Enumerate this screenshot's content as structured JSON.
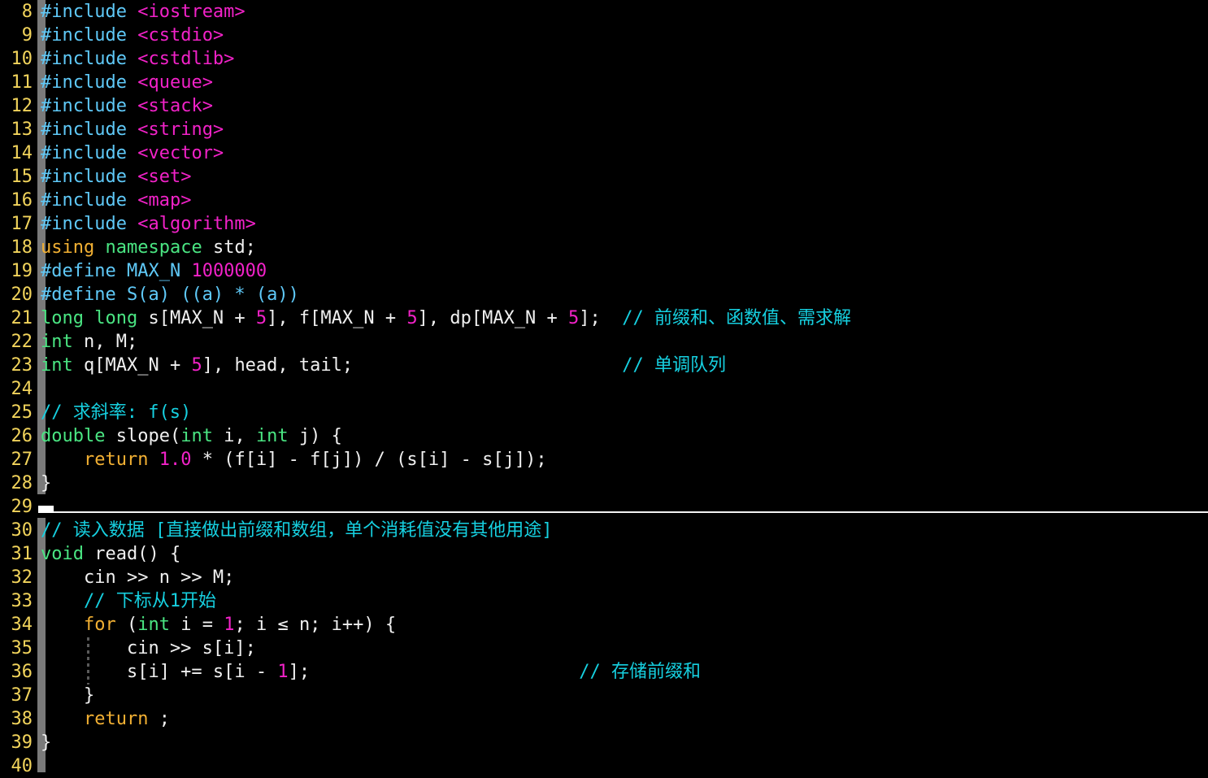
{
  "editor": {
    "name": "code-editor",
    "language": "cpp",
    "first_line": 8,
    "last_line": 40,
    "background": "#000000",
    "gutter_color": "#f2d45c",
    "fold_bar_color": "#7a7a7a",
    "separator_color": "#f2f2f2",
    "colors": {
      "preprocessor": "#5fc9f8",
      "header": "#f222c8",
      "keyword": "#f2b033",
      "type": "#4ae582",
      "number": "#f222c8",
      "plain": "#f0f0f0",
      "comment": "#16d0e0"
    }
  },
  "lines": [
    {
      "n": "8",
      "text": "#include <iostream>"
    },
    {
      "n": "9",
      "text": "#include <cstdio>"
    },
    {
      "n": "10",
      "text": "#include <cstdlib>"
    },
    {
      "n": "11",
      "text": "#include <queue>"
    },
    {
      "n": "12",
      "text": "#include <stack>"
    },
    {
      "n": "13",
      "text": "#include <string>"
    },
    {
      "n": "14",
      "text": "#include <vector>"
    },
    {
      "n": "15",
      "text": "#include <set>"
    },
    {
      "n": "16",
      "text": "#include <map>"
    },
    {
      "n": "17",
      "text": "#include <algorithm>"
    },
    {
      "n": "18",
      "text": "using namespace std;"
    },
    {
      "n": "19",
      "text": "#define MAX_N 1000000"
    },
    {
      "n": "20",
      "text": "#define S(a) ((a) * (a))"
    },
    {
      "n": "21",
      "text": "long long s[MAX_N + 5], f[MAX_N + 5], dp[MAX_N + 5];  // 前缀和、函数值、需求解"
    },
    {
      "n": "22",
      "text": "int n, M;"
    },
    {
      "n": "23",
      "text": "int q[MAX_N + 5], head, tail;                         // 单调队列"
    },
    {
      "n": "24",
      "text": ""
    },
    {
      "n": "25",
      "text": "// 求斜率: f(s)"
    },
    {
      "n": "26",
      "text": "double slope(int i, int j) {"
    },
    {
      "n": "27",
      "text": "    return 1.0 * (f[i] - f[j]) / (s[i] - s[j]);"
    },
    {
      "n": "28",
      "text": "}"
    },
    {
      "n": "29",
      "text": ""
    },
    {
      "n": "30",
      "text": "// 读入数据 [直接做出前缀和数组，单个消耗值没有其他用途]"
    },
    {
      "n": "31",
      "text": "void read() {"
    },
    {
      "n": "32",
      "text": "    cin >> n >> M;"
    },
    {
      "n": "33",
      "text": "    // 下标从1开始"
    },
    {
      "n": "34",
      "text": "    for (int i = 1; i ≤ n; i++) {"
    },
    {
      "n": "35",
      "text": "        cin >> s[i];"
    },
    {
      "n": "36",
      "text": "        s[i] += s[i - 1];                         // 存储前缀和"
    },
    {
      "n": "37",
      "text": "    }"
    },
    {
      "n": "38",
      "text": "    return ;"
    },
    {
      "n": "39",
      "text": "}"
    },
    {
      "n": "40",
      "text": ""
    }
  ],
  "tokens": {
    "l8": [
      [
        "#include",
        "t-pre"
      ],
      [
        " ",
        "t-plain"
      ],
      [
        "<iostream>",
        "t-header"
      ]
    ],
    "l9": [
      [
        "#include",
        "t-pre"
      ],
      [
        " ",
        "t-plain"
      ],
      [
        "<cstdio>",
        "t-header"
      ]
    ],
    "l10": [
      [
        "#include",
        "t-pre"
      ],
      [
        " ",
        "t-plain"
      ],
      [
        "<cstdlib>",
        "t-header"
      ]
    ],
    "l11": [
      [
        "#include",
        "t-pre"
      ],
      [
        " ",
        "t-plain"
      ],
      [
        "<queue>",
        "t-header"
      ]
    ],
    "l12": [
      [
        "#include",
        "t-pre"
      ],
      [
        " ",
        "t-plain"
      ],
      [
        "<stack>",
        "t-header"
      ]
    ],
    "l13": [
      [
        "#include",
        "t-pre"
      ],
      [
        " ",
        "t-plain"
      ],
      [
        "<string>",
        "t-header"
      ]
    ],
    "l14": [
      [
        "#include",
        "t-pre"
      ],
      [
        " ",
        "t-plain"
      ],
      [
        "<vector>",
        "t-header"
      ]
    ],
    "l15": [
      [
        "#include",
        "t-pre"
      ],
      [
        " ",
        "t-plain"
      ],
      [
        "<set>",
        "t-header"
      ]
    ],
    "l16": [
      [
        "#include",
        "t-pre"
      ],
      [
        " ",
        "t-plain"
      ],
      [
        "<map>",
        "t-header"
      ]
    ],
    "l17": [
      [
        "#include",
        "t-pre"
      ],
      [
        " ",
        "t-plain"
      ],
      [
        "<algorithm>",
        "t-header"
      ]
    ],
    "l18": [
      [
        "using",
        "t-kw"
      ],
      [
        " ",
        "t-plain"
      ],
      [
        "namespace",
        "t-type"
      ],
      [
        " std;",
        "t-plain"
      ]
    ],
    "l19": [
      [
        "#define",
        "t-pre"
      ],
      [
        " ",
        "t-plain"
      ],
      [
        "MAX_N",
        "t-macroid"
      ],
      [
        " ",
        "t-plain"
      ],
      [
        "1000000",
        "t-num"
      ]
    ],
    "l20": [
      [
        "#define",
        "t-pre"
      ],
      [
        " ",
        "t-plain"
      ],
      [
        "S(a) ((a) * (a))",
        "t-macroid"
      ]
    ],
    "l21": [
      [
        "long long",
        "t-type"
      ],
      [
        " s[MAX_N + ",
        "t-plain"
      ],
      [
        "5",
        "t-num"
      ],
      [
        "], f[MAX_N + ",
        "t-plain"
      ],
      [
        "5",
        "t-num"
      ],
      [
        "], dp[MAX_N + ",
        "t-plain"
      ],
      [
        "5",
        "t-num"
      ],
      [
        "];  ",
        "t-plain"
      ],
      [
        "// 前缀和、函数值、需求解",
        "t-comment"
      ]
    ],
    "l22": [
      [
        "int",
        "t-type"
      ],
      [
        " n, M;",
        "t-plain"
      ]
    ],
    "l23": [
      [
        "int",
        "t-type"
      ],
      [
        " q[MAX_N + ",
        "t-plain"
      ],
      [
        "5",
        "t-num"
      ],
      [
        "], head, tail;                         ",
        "t-plain"
      ],
      [
        "// 单调队列",
        "t-comment"
      ]
    ],
    "l24": [],
    "l25": [
      [
        "// 求斜率: f(s)",
        "t-comment"
      ]
    ],
    "l26": [
      [
        "double",
        "t-type"
      ],
      [
        " slope(",
        "t-plain"
      ],
      [
        "int",
        "t-type"
      ],
      [
        " i, ",
        "t-plain"
      ],
      [
        "int",
        "t-type"
      ],
      [
        " j) {",
        "t-plain"
      ]
    ],
    "l27": [
      [
        "    ",
        "t-plain"
      ],
      [
        "return",
        "t-kw"
      ],
      [
        " ",
        "t-plain"
      ],
      [
        "1.0",
        "t-num"
      ],
      [
        " * (f[i] - f[j]) / (s[i] - s[j]);",
        "t-plain"
      ]
    ],
    "l28": [
      [
        "}",
        "t-plain"
      ]
    ],
    "l29": [],
    "l30": [
      [
        "// 读入数据 [直接做出前缀和数组，单个消耗值没有其他用途]",
        "t-comment"
      ]
    ],
    "l31": [
      [
        "void",
        "t-type"
      ],
      [
        " read() {",
        "t-plain"
      ]
    ],
    "l32": [
      [
        "    cin >> n >> M;",
        "t-plain"
      ]
    ],
    "l33": [
      [
        "    ",
        "t-plain"
      ],
      [
        "// 下标从1开始",
        "t-comment"
      ]
    ],
    "l34": [
      [
        "    ",
        "t-plain"
      ],
      [
        "for",
        "t-kw"
      ],
      [
        " (",
        "t-plain"
      ],
      [
        "int",
        "t-type"
      ],
      [
        " i = ",
        "t-plain"
      ],
      [
        "1",
        "t-num"
      ],
      [
        "; i ≤ n; i++) {",
        "t-plain"
      ]
    ],
    "l35": [
      [
        "        cin >> s[i];",
        "t-plain"
      ]
    ],
    "l36": [
      [
        "        s[i] += s[i - ",
        "t-plain"
      ],
      [
        "1",
        "t-num"
      ],
      [
        "];                         ",
        "t-plain"
      ],
      [
        "// 存储前缀和",
        "t-comment"
      ]
    ],
    "l37": [
      [
        "    }",
        "t-plain"
      ]
    ],
    "l38": [
      [
        "    ",
        "t-plain"
      ],
      [
        "return",
        "t-kw"
      ],
      [
        " ;",
        "t-plain"
      ]
    ],
    "l39": [
      [
        "}",
        "t-plain"
      ]
    ],
    "l40": []
  }
}
